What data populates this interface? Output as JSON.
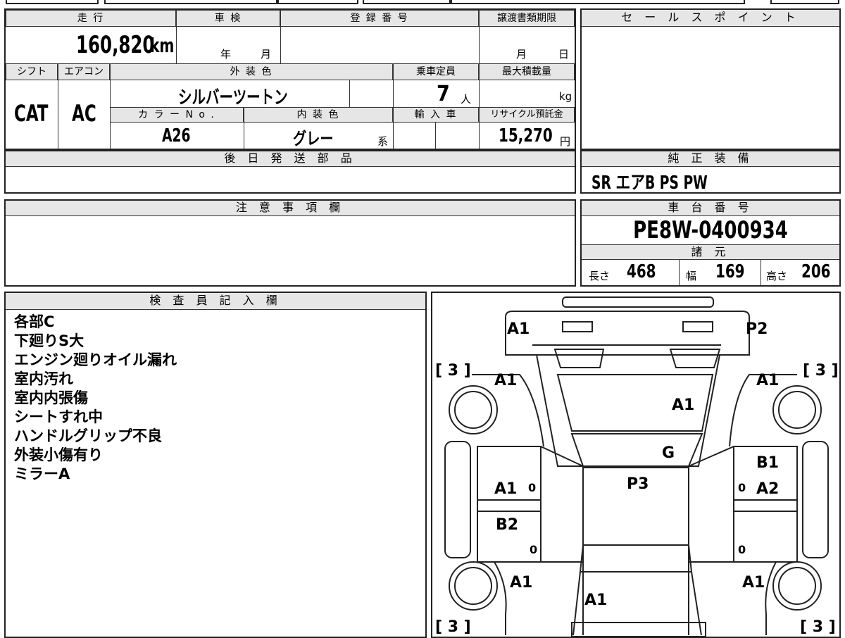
{
  "labels": {
    "mileage": "走 行",
    "shaken": "車 検",
    "reg_no": "登 録 番 号",
    "transfer_deadline": "譲渡書類期限",
    "sales_point": "セ ー ル ス ポ イ ン ト",
    "shift": "シフト",
    "aircon": "エアコン",
    "ext_color": "外 装 色",
    "capacity": "乗車定員",
    "max_load": "最大積載量",
    "color_no": "カ ラ ー N o .",
    "int_color": "内 装 色",
    "import": "輸 入 車",
    "recycle": "リサイクル預託金",
    "later_parts": "後 日 発 送 部 品",
    "genuine_equipment": "純 正 装 備",
    "caution": "注 意 事 項 欄",
    "chassis_no": "車 台 番 号",
    "specs": "諸 元",
    "inspector": "検 査 員 記 入 欄"
  },
  "values": {
    "mileage_num": "160,820",
    "mileage_unit": "km",
    "year_unit": "年",
    "month_unit": "月",
    "deadline_month": "月",
    "deadline_day": "日",
    "shift": "CAT",
    "aircon": "AC",
    "ext_color": "シルバーツートン",
    "capacity": "7",
    "capacity_unit": "人",
    "max_load_unit": "kg",
    "color_no": "A26",
    "int_color": "グレー",
    "int_color_suffix": "系",
    "recycle": "15,270",
    "recycle_unit": "円",
    "equipment": "SR エアB PS PW",
    "chassis_no": "PE8W-0400934",
    "length_label": "長さ",
    "length": "468",
    "width_label": "幅",
    "width": "169",
    "height_label": "高さ",
    "height": "206"
  },
  "inspector_notes": [
    "各部C",
    "下廻りS大",
    "エンジン廻りオイル漏れ",
    "室内汚れ",
    "室内内張傷",
    "シートすれ中",
    "ハンドルグリップ不良",
    "外装小傷有り",
    "ミラーA"
  ],
  "diagram": {
    "front_left": "A1",
    "front_right": "P2",
    "tire_fl": "[ 3 ]",
    "tire_fr": "[ 3 ]",
    "tire_rl": "[ 3 ]",
    "tire_rr": "[ 3 ]",
    "fender_fl": "A1",
    "fender_fr": "A1",
    "hood": "A1",
    "windshield": "G",
    "roof": "P3",
    "front_door_l": "A1",
    "front_door_r": "A2",
    "front_door_r_top": "B1",
    "rear_door_l": "B2",
    "rear_fender_l": "A1",
    "rear_fender_r": "A1",
    "rear": "A1",
    "zero": "0"
  }
}
